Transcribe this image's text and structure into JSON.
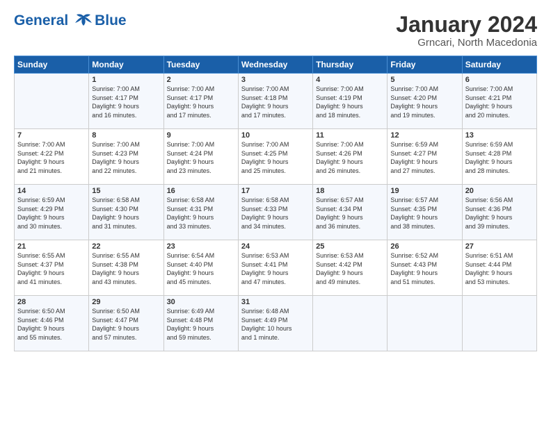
{
  "header": {
    "logo_line1": "General",
    "logo_line2": "Blue",
    "month": "January 2024",
    "location": "Grncari, North Macedonia"
  },
  "weekdays": [
    "Sunday",
    "Monday",
    "Tuesday",
    "Wednesday",
    "Thursday",
    "Friday",
    "Saturday"
  ],
  "weeks": [
    [
      {
        "day": "",
        "info": ""
      },
      {
        "day": "1",
        "info": "Sunrise: 7:00 AM\nSunset: 4:17 PM\nDaylight: 9 hours\nand 16 minutes."
      },
      {
        "day": "2",
        "info": "Sunrise: 7:00 AM\nSunset: 4:17 PM\nDaylight: 9 hours\nand 17 minutes."
      },
      {
        "day": "3",
        "info": "Sunrise: 7:00 AM\nSunset: 4:18 PM\nDaylight: 9 hours\nand 17 minutes."
      },
      {
        "day": "4",
        "info": "Sunrise: 7:00 AM\nSunset: 4:19 PM\nDaylight: 9 hours\nand 18 minutes."
      },
      {
        "day": "5",
        "info": "Sunrise: 7:00 AM\nSunset: 4:20 PM\nDaylight: 9 hours\nand 19 minutes."
      },
      {
        "day": "6",
        "info": "Sunrise: 7:00 AM\nSunset: 4:21 PM\nDaylight: 9 hours\nand 20 minutes."
      }
    ],
    [
      {
        "day": "7",
        "info": "Sunrise: 7:00 AM\nSunset: 4:22 PM\nDaylight: 9 hours\nand 21 minutes."
      },
      {
        "day": "8",
        "info": "Sunrise: 7:00 AM\nSunset: 4:23 PM\nDaylight: 9 hours\nand 22 minutes."
      },
      {
        "day": "9",
        "info": "Sunrise: 7:00 AM\nSunset: 4:24 PM\nDaylight: 9 hours\nand 23 minutes."
      },
      {
        "day": "10",
        "info": "Sunrise: 7:00 AM\nSunset: 4:25 PM\nDaylight: 9 hours\nand 25 minutes."
      },
      {
        "day": "11",
        "info": "Sunrise: 7:00 AM\nSunset: 4:26 PM\nDaylight: 9 hours\nand 26 minutes."
      },
      {
        "day": "12",
        "info": "Sunrise: 6:59 AM\nSunset: 4:27 PM\nDaylight: 9 hours\nand 27 minutes."
      },
      {
        "day": "13",
        "info": "Sunrise: 6:59 AM\nSunset: 4:28 PM\nDaylight: 9 hours\nand 28 minutes."
      }
    ],
    [
      {
        "day": "14",
        "info": "Sunrise: 6:59 AM\nSunset: 4:29 PM\nDaylight: 9 hours\nand 30 minutes."
      },
      {
        "day": "15",
        "info": "Sunrise: 6:58 AM\nSunset: 4:30 PM\nDaylight: 9 hours\nand 31 minutes."
      },
      {
        "day": "16",
        "info": "Sunrise: 6:58 AM\nSunset: 4:31 PM\nDaylight: 9 hours\nand 33 minutes."
      },
      {
        "day": "17",
        "info": "Sunrise: 6:58 AM\nSunset: 4:33 PM\nDaylight: 9 hours\nand 34 minutes."
      },
      {
        "day": "18",
        "info": "Sunrise: 6:57 AM\nSunset: 4:34 PM\nDaylight: 9 hours\nand 36 minutes."
      },
      {
        "day": "19",
        "info": "Sunrise: 6:57 AM\nSunset: 4:35 PM\nDaylight: 9 hours\nand 38 minutes."
      },
      {
        "day": "20",
        "info": "Sunrise: 6:56 AM\nSunset: 4:36 PM\nDaylight: 9 hours\nand 39 minutes."
      }
    ],
    [
      {
        "day": "21",
        "info": "Sunrise: 6:55 AM\nSunset: 4:37 PM\nDaylight: 9 hours\nand 41 minutes."
      },
      {
        "day": "22",
        "info": "Sunrise: 6:55 AM\nSunset: 4:38 PM\nDaylight: 9 hours\nand 43 minutes."
      },
      {
        "day": "23",
        "info": "Sunrise: 6:54 AM\nSunset: 4:40 PM\nDaylight: 9 hours\nand 45 minutes."
      },
      {
        "day": "24",
        "info": "Sunrise: 6:53 AM\nSunset: 4:41 PM\nDaylight: 9 hours\nand 47 minutes."
      },
      {
        "day": "25",
        "info": "Sunrise: 6:53 AM\nSunset: 4:42 PM\nDaylight: 9 hours\nand 49 minutes."
      },
      {
        "day": "26",
        "info": "Sunrise: 6:52 AM\nSunset: 4:43 PM\nDaylight: 9 hours\nand 51 minutes."
      },
      {
        "day": "27",
        "info": "Sunrise: 6:51 AM\nSunset: 4:44 PM\nDaylight: 9 hours\nand 53 minutes."
      }
    ],
    [
      {
        "day": "28",
        "info": "Sunrise: 6:50 AM\nSunset: 4:46 PM\nDaylight: 9 hours\nand 55 minutes."
      },
      {
        "day": "29",
        "info": "Sunrise: 6:50 AM\nSunset: 4:47 PM\nDaylight: 9 hours\nand 57 minutes."
      },
      {
        "day": "30",
        "info": "Sunrise: 6:49 AM\nSunset: 4:48 PM\nDaylight: 9 hours\nand 59 minutes."
      },
      {
        "day": "31",
        "info": "Sunrise: 6:48 AM\nSunset: 4:49 PM\nDaylight: 10 hours\nand 1 minute."
      },
      {
        "day": "",
        "info": ""
      },
      {
        "day": "",
        "info": ""
      },
      {
        "day": "",
        "info": ""
      }
    ]
  ]
}
